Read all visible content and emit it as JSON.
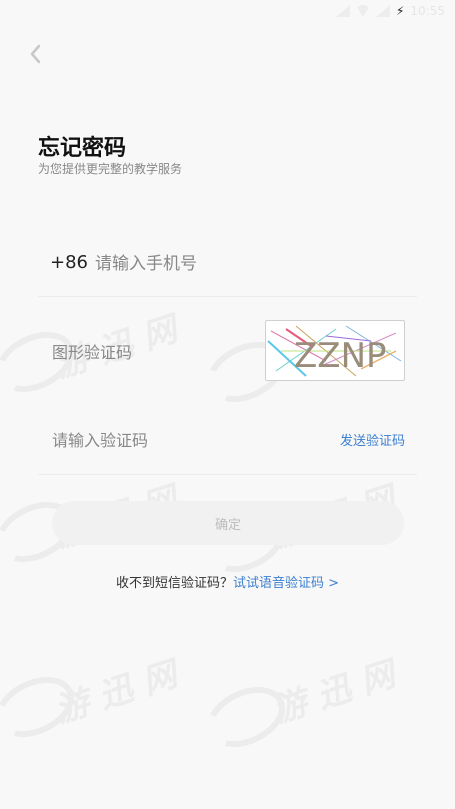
{
  "status_bar": {
    "time": "10:55"
  },
  "page": {
    "title": "忘记密码",
    "subtitle": "为您提供更完整的教学服务"
  },
  "form": {
    "country_code": "+86",
    "phone_placeholder": "请输入手机号",
    "captcha_placeholder": "图形验证码",
    "captcha_text": "ZZNP",
    "sms_placeholder": "请输入验证码",
    "send_code_label": "发送验证码",
    "confirm_label": "确定"
  },
  "footer": {
    "no_code_text": "收不到短信验证码？",
    "voice_link": "试试语音验证码 >"
  },
  "watermark": {
    "text": "游 迅 网"
  },
  "colors": {
    "link": "#3b7fd0",
    "background": "#f8f8f8",
    "button_disabled": "#f1f1f1"
  }
}
